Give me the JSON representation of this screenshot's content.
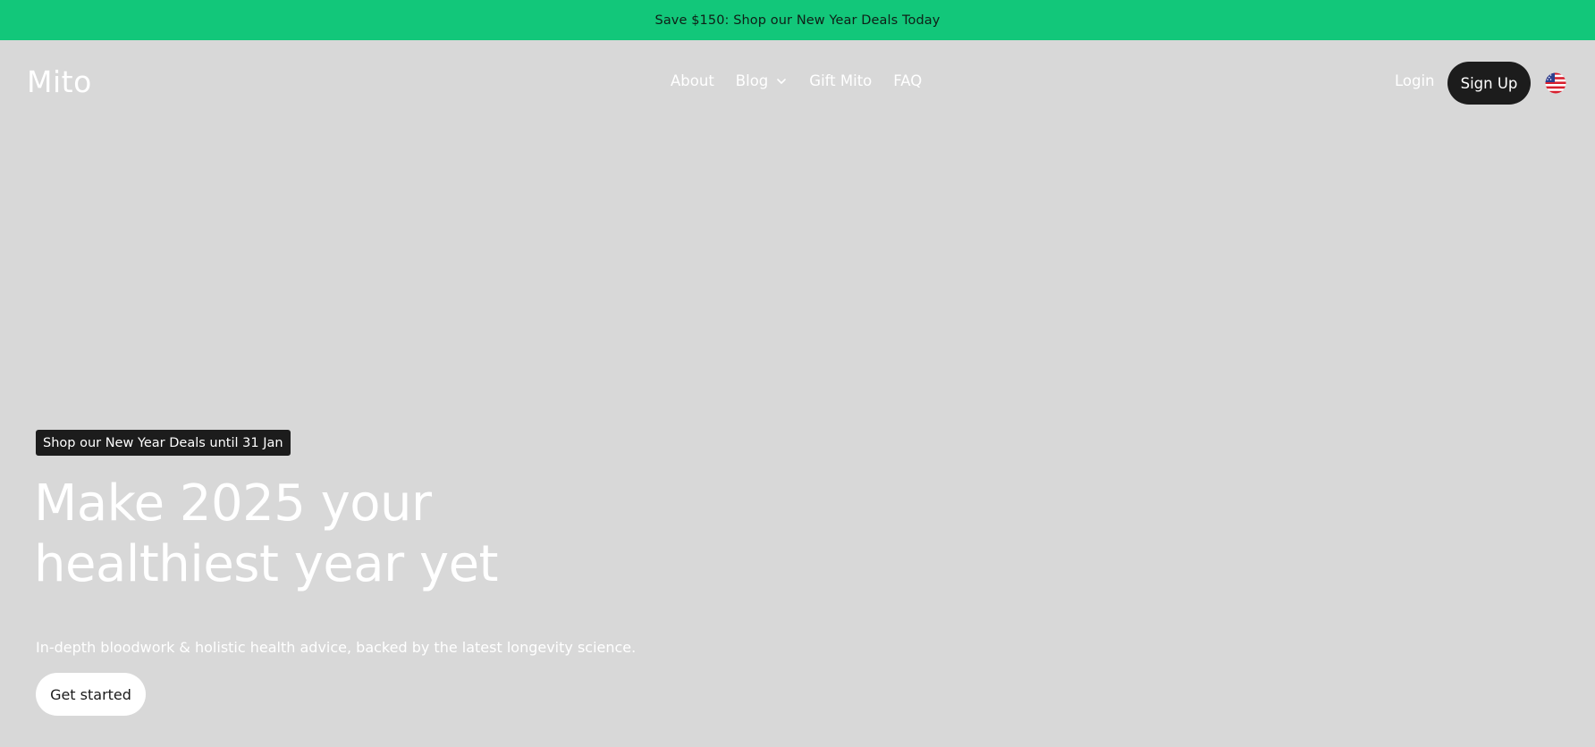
{
  "promo_bar": {
    "text": "Save $150: Shop our New Year Deals Today"
  },
  "header": {
    "logo": "Mito",
    "nav": {
      "about": "About",
      "blog": "Blog",
      "gift": "Gift Mito",
      "faq": "FAQ"
    },
    "login": "Login",
    "signup": "Sign Up",
    "locale_icon": "us-flag-icon"
  },
  "hero": {
    "deal_tag": "Shop our New Year Deals until 31 Jan",
    "headline_line1": "Make 2025 your",
    "headline_line2": "healthiest year yet",
    "subtext": "In-depth bloodwork & holistic health advice, backed by the latest longevity science.",
    "cta": "Get started"
  },
  "colors": {
    "promo_bg": "#12c77a",
    "page_bg": "#d8d8d8",
    "dark": "#1c1c1c",
    "white": "#ffffff"
  }
}
